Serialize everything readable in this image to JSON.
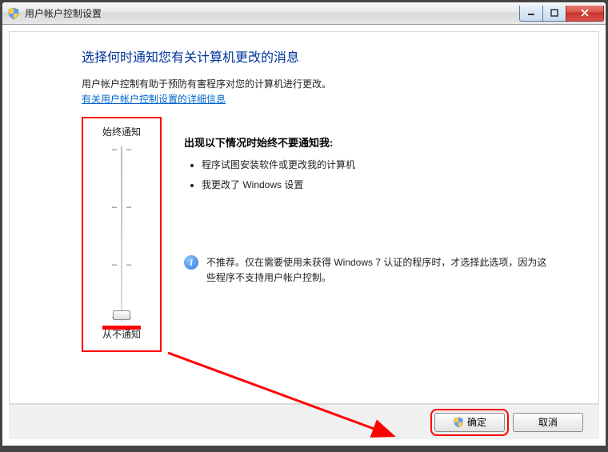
{
  "window": {
    "title": "用户帐户控制设置"
  },
  "heading": "选择何时通知您有关计算机更改的消息",
  "description": "用户帐户控制有助于预防有害程序对您的计算机进行更改。",
  "link": "有关用户帐户控制设置的详细信息",
  "slider": {
    "top_label": "始终通知",
    "bottom_label": "从不通知"
  },
  "right": {
    "title": "出现以下情况时始终不要通知我:",
    "item1": "程序试图安装软件或更改我的计算机",
    "item2": "我更改了 Windows 设置"
  },
  "info": "不推荐。仅在需要使用未获得 Windows 7 认证的程序时，才选择此选项，因为这些程序不支持用户帐户控制。",
  "buttons": {
    "ok": "确定",
    "cancel": "取消"
  }
}
